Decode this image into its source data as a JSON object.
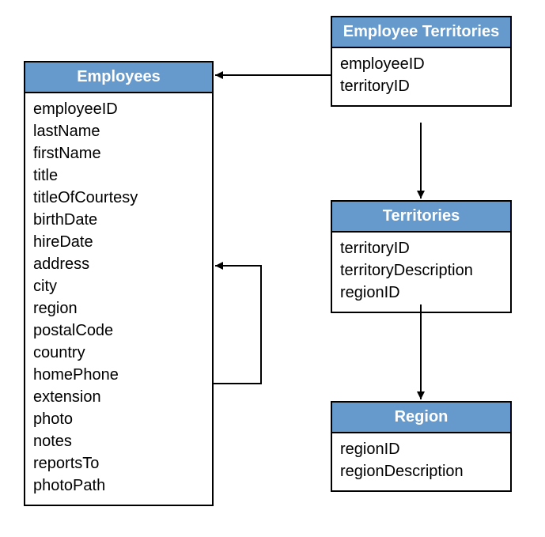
{
  "entities": {
    "employees": {
      "title": "Employees",
      "fields": [
        "employeeID",
        "lastName",
        "firstName",
        "title",
        "titleOfCourtesy",
        "birthDate",
        "hireDate",
        "address",
        "city",
        "region",
        "postalCode",
        "country",
        "homePhone",
        "extension",
        "photo",
        "notes",
        "reportsTo",
        "photoPath"
      ]
    },
    "employeeTerritories": {
      "title": "Employee Territories",
      "fields": [
        "employeeID",
        "territoryID"
      ]
    },
    "territories": {
      "title": "Territories",
      "fields": [
        "territoryID",
        "territoryDescription",
        "regionID"
      ]
    },
    "region": {
      "title": "Region",
      "fields": [
        "regionID",
        "regionDescription"
      ]
    }
  },
  "relationships": [
    {
      "from": "employeeTerritories",
      "to": "employees",
      "desc": "EmployeeTerritories → Employees"
    },
    {
      "from": "employees",
      "to": "employees",
      "desc": "Employees self-reference (reportsTo)"
    },
    {
      "from": "employeeTerritories",
      "to": "territories",
      "desc": "EmployeeTerritories → Territories"
    },
    {
      "from": "territories",
      "to": "region",
      "desc": "Territories → Region"
    }
  ]
}
